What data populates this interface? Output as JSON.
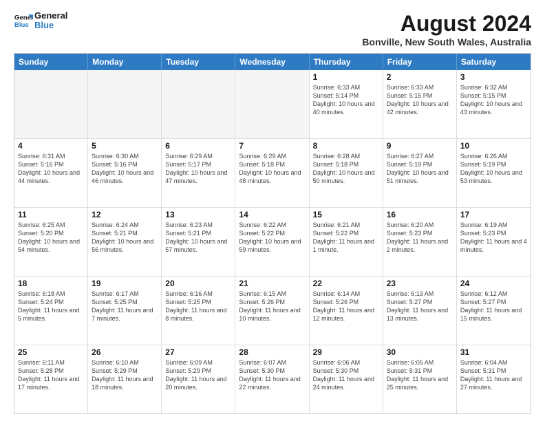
{
  "header": {
    "logo_line1": "General",
    "logo_line2": "Blue",
    "month_year": "August 2024",
    "location": "Bonville, New South Wales, Australia"
  },
  "weekdays": [
    "Sunday",
    "Monday",
    "Tuesday",
    "Wednesday",
    "Thursday",
    "Friday",
    "Saturday"
  ],
  "rows": [
    [
      {
        "day": "",
        "info": "",
        "empty": true
      },
      {
        "day": "",
        "info": "",
        "empty": true
      },
      {
        "day": "",
        "info": "",
        "empty": true
      },
      {
        "day": "",
        "info": "",
        "empty": true
      },
      {
        "day": "1",
        "info": "Sunrise: 6:33 AM\nSunset: 5:14 PM\nDaylight: 10 hours\nand 40 minutes.",
        "empty": false
      },
      {
        "day": "2",
        "info": "Sunrise: 6:33 AM\nSunset: 5:15 PM\nDaylight: 10 hours\nand 42 minutes.",
        "empty": false
      },
      {
        "day": "3",
        "info": "Sunrise: 6:32 AM\nSunset: 5:15 PM\nDaylight: 10 hours\nand 43 minutes.",
        "empty": false
      }
    ],
    [
      {
        "day": "4",
        "info": "Sunrise: 6:31 AM\nSunset: 5:16 PM\nDaylight: 10 hours\nand 44 minutes.",
        "empty": false
      },
      {
        "day": "5",
        "info": "Sunrise: 6:30 AM\nSunset: 5:16 PM\nDaylight: 10 hours\nand 46 minutes.",
        "empty": false
      },
      {
        "day": "6",
        "info": "Sunrise: 6:29 AM\nSunset: 5:17 PM\nDaylight: 10 hours\nand 47 minutes.",
        "empty": false
      },
      {
        "day": "7",
        "info": "Sunrise: 6:29 AM\nSunset: 5:18 PM\nDaylight: 10 hours\nand 48 minutes.",
        "empty": false
      },
      {
        "day": "8",
        "info": "Sunrise: 6:28 AM\nSunset: 5:18 PM\nDaylight: 10 hours\nand 50 minutes.",
        "empty": false
      },
      {
        "day": "9",
        "info": "Sunrise: 6:27 AM\nSunset: 5:19 PM\nDaylight: 10 hours\nand 51 minutes.",
        "empty": false
      },
      {
        "day": "10",
        "info": "Sunrise: 6:26 AM\nSunset: 5:19 PM\nDaylight: 10 hours\nand 53 minutes.",
        "empty": false
      }
    ],
    [
      {
        "day": "11",
        "info": "Sunrise: 6:25 AM\nSunset: 5:20 PM\nDaylight: 10 hours\nand 54 minutes.",
        "empty": false
      },
      {
        "day": "12",
        "info": "Sunrise: 6:24 AM\nSunset: 5:21 PM\nDaylight: 10 hours\nand 56 minutes.",
        "empty": false
      },
      {
        "day": "13",
        "info": "Sunrise: 6:23 AM\nSunset: 5:21 PM\nDaylight: 10 hours\nand 57 minutes.",
        "empty": false
      },
      {
        "day": "14",
        "info": "Sunrise: 6:22 AM\nSunset: 5:22 PM\nDaylight: 10 hours\nand 59 minutes.",
        "empty": false
      },
      {
        "day": "15",
        "info": "Sunrise: 6:21 AM\nSunset: 5:22 PM\nDaylight: 11 hours\nand 1 minute.",
        "empty": false
      },
      {
        "day": "16",
        "info": "Sunrise: 6:20 AM\nSunset: 5:23 PM\nDaylight: 11 hours\nand 2 minutes.",
        "empty": false
      },
      {
        "day": "17",
        "info": "Sunrise: 6:19 AM\nSunset: 5:23 PM\nDaylight: 11 hours\nand 4 minutes.",
        "empty": false
      }
    ],
    [
      {
        "day": "18",
        "info": "Sunrise: 6:18 AM\nSunset: 5:24 PM\nDaylight: 11 hours\nand 5 minutes.",
        "empty": false
      },
      {
        "day": "19",
        "info": "Sunrise: 6:17 AM\nSunset: 5:25 PM\nDaylight: 11 hours\nand 7 minutes.",
        "empty": false
      },
      {
        "day": "20",
        "info": "Sunrise: 6:16 AM\nSunset: 5:25 PM\nDaylight: 11 hours\nand 8 minutes.",
        "empty": false
      },
      {
        "day": "21",
        "info": "Sunrise: 6:15 AM\nSunset: 5:26 PM\nDaylight: 11 hours\nand 10 minutes.",
        "empty": false
      },
      {
        "day": "22",
        "info": "Sunrise: 6:14 AM\nSunset: 5:26 PM\nDaylight: 11 hours\nand 12 minutes.",
        "empty": false
      },
      {
        "day": "23",
        "info": "Sunrise: 6:13 AM\nSunset: 5:27 PM\nDaylight: 11 hours\nand 13 minutes.",
        "empty": false
      },
      {
        "day": "24",
        "info": "Sunrise: 6:12 AM\nSunset: 5:27 PM\nDaylight: 11 hours\nand 15 minutes.",
        "empty": false
      }
    ],
    [
      {
        "day": "25",
        "info": "Sunrise: 6:11 AM\nSunset: 5:28 PM\nDaylight: 11 hours\nand 17 minutes.",
        "empty": false
      },
      {
        "day": "26",
        "info": "Sunrise: 6:10 AM\nSunset: 5:29 PM\nDaylight: 11 hours\nand 18 minutes.",
        "empty": false
      },
      {
        "day": "27",
        "info": "Sunrise: 6:09 AM\nSunset: 5:29 PM\nDaylight: 11 hours\nand 20 minutes.",
        "empty": false
      },
      {
        "day": "28",
        "info": "Sunrise: 6:07 AM\nSunset: 5:30 PM\nDaylight: 11 hours\nand 22 minutes.",
        "empty": false
      },
      {
        "day": "29",
        "info": "Sunrise: 6:06 AM\nSunset: 5:30 PM\nDaylight: 11 hours\nand 24 minutes.",
        "empty": false
      },
      {
        "day": "30",
        "info": "Sunrise: 6:05 AM\nSunset: 5:31 PM\nDaylight: 11 hours\nand 25 minutes.",
        "empty": false
      },
      {
        "day": "31",
        "info": "Sunrise: 6:04 AM\nSunset: 5:31 PM\nDaylight: 11 hours\nand 27 minutes.",
        "empty": false
      }
    ]
  ]
}
